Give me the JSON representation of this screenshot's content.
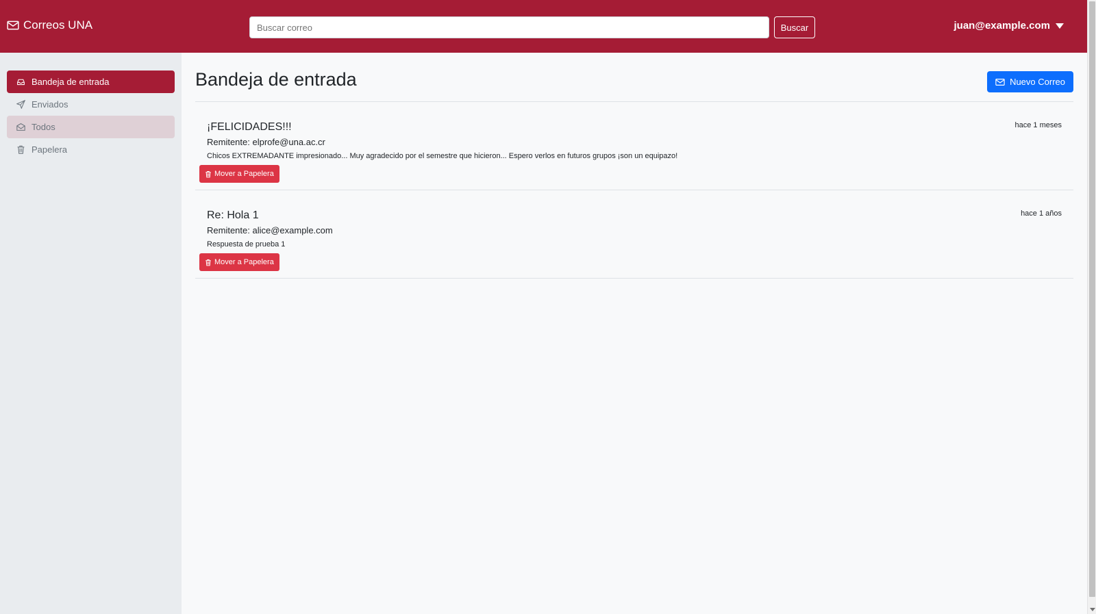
{
  "brand": {
    "name": "Correos UNA",
    "icon": "envelope-icon"
  },
  "search": {
    "placeholder": "Buscar correo",
    "button_label": "Buscar"
  },
  "user": {
    "email": "juan@example.com"
  },
  "sidebar": {
    "items": [
      {
        "label": "Bandeja de entrada",
        "icon": "inbox-icon",
        "state": "active"
      },
      {
        "label": "Enviados",
        "icon": "send-icon",
        "state": "normal"
      },
      {
        "label": "Todos",
        "icon": "envelope-open-icon",
        "state": "hover"
      },
      {
        "label": "Papelera",
        "icon": "trash-icon",
        "state": "normal"
      }
    ]
  },
  "main": {
    "title": "Bandeja de entrada",
    "new_mail_label": "Nuevo Correo",
    "trash_button_label": "Mover a Papelera",
    "emails": [
      {
        "subject": "¡FELICIDADES!!!",
        "sender": "Remitente: elprofe@una.ac.cr",
        "preview": "Chicos EXTREMADANTE impresionado... Muy agradecido por el semestre que hicieron... Espero verlos en futuros grupos ¡son un equipazo!",
        "time": "hace 1 meses"
      },
      {
        "subject": "Re: Hola 1",
        "sender": "Remitente: alice@example.com",
        "preview": "Respuesta de prueba 1",
        "time": "hace 1 años"
      }
    ]
  },
  "colors": {
    "navbar": "#a51c35",
    "primary": "#0d6efd",
    "danger": "#dc3545"
  }
}
